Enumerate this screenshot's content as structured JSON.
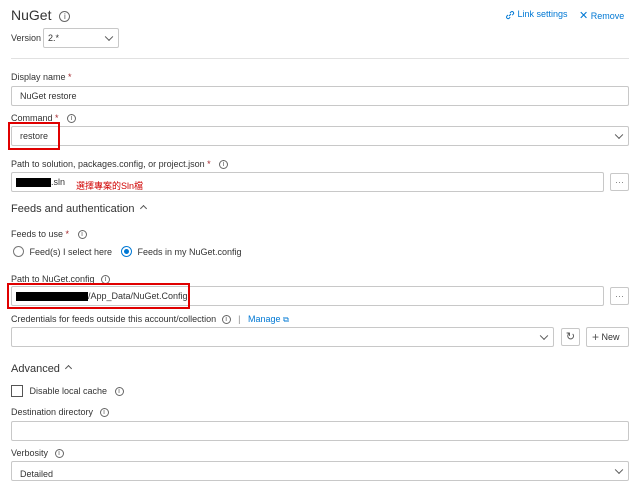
{
  "header": {
    "title": "NuGet",
    "link_settings": "Link settings",
    "remove": "Remove",
    "link_icon": "link-icon",
    "remove_icon": "x-icon"
  },
  "version": {
    "label": "Version",
    "value": "2.*"
  },
  "display_name": {
    "label": "Display name",
    "required": "*",
    "value": "NuGet restore"
  },
  "command": {
    "label": "Command",
    "required": "*",
    "value": "restore"
  },
  "path_solution": {
    "label": "Path to solution, packages.config, or project.json",
    "required": "*",
    "value_suffix": ".sln",
    "annotation": "選擇專案的Sln檔",
    "more": "···"
  },
  "feeds_section": {
    "title": "Feeds and authentication"
  },
  "feeds_to_use": {
    "label": "Feeds to use",
    "required": "*",
    "options": [
      "Feed(s) I select here",
      "Feeds in my NuGet.config"
    ],
    "selected": "Feeds in my NuGet.config"
  },
  "nuget_config": {
    "label": "Path to NuGet.config",
    "value_suffix": "/App_Data/NuGet.Config",
    "more": "···"
  },
  "credentials": {
    "label": "Credentials for feeds outside this account/collection",
    "separator": "|",
    "manage": "Manage",
    "new_button": "New",
    "refresh_icon": "refresh-icon"
  },
  "advanced_section": {
    "title": "Advanced"
  },
  "disable_cache": {
    "label": "Disable local cache"
  },
  "destination": {
    "label": "Destination directory",
    "value": ""
  },
  "verbosity": {
    "label": "Verbosity",
    "value": "Detailed"
  },
  "colors": {
    "accent": "#0078d4",
    "required": "#a4262c",
    "annotation_red": "#e00000"
  }
}
